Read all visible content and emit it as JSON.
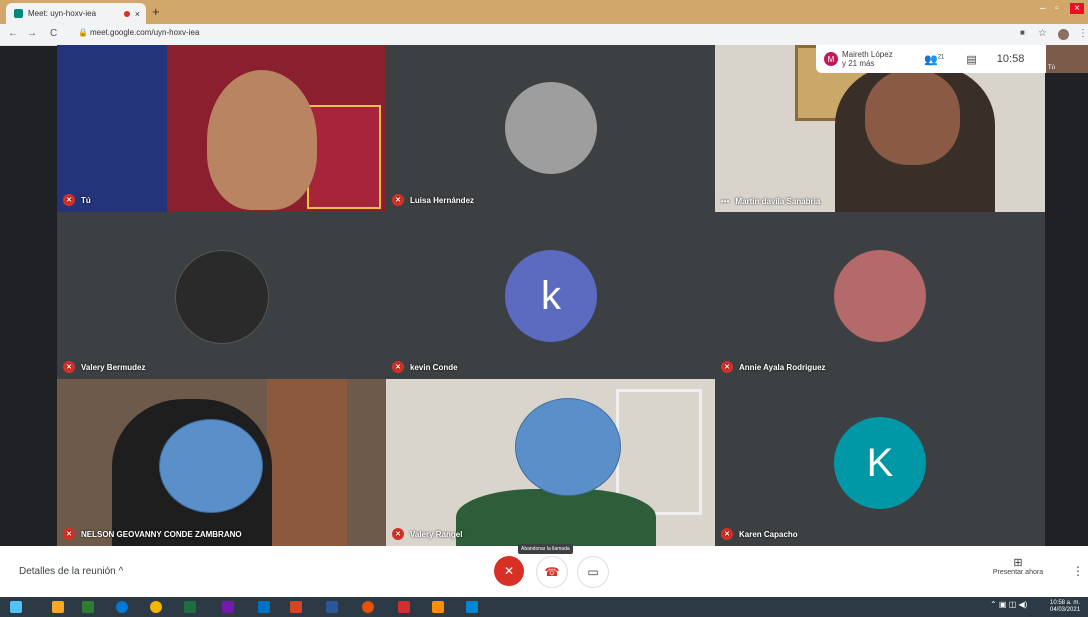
{
  "browser": {
    "tab_title": "Meet: uyn-hoxv-iea",
    "tab_close": "×",
    "new_tab": "+",
    "url": "meet.google.com/uyn-hoxv-iea",
    "back": "←",
    "forward": "→",
    "reload": "C",
    "lock": "🔒",
    "minimize": "–",
    "maximize": "▫",
    "close": "×"
  },
  "participants": [
    {
      "name": "Tú",
      "muted": true
    },
    {
      "name": "Luisa Hernández",
      "muted": true
    },
    {
      "name": "Martin davila Sanabria",
      "muted": false
    },
    {
      "name": "Valery Bermudez",
      "muted": true
    },
    {
      "name": "kevin Conde",
      "muted": true,
      "avatar_letter": "k",
      "avatar_color": "#5c6bc0"
    },
    {
      "name": "Annie Ayala Rodriguez",
      "muted": true
    },
    {
      "name": "NELSON GEOVANNY CONDE ZAMBRANO",
      "muted": true
    },
    {
      "name": "Valery Rangel",
      "muted": true
    },
    {
      "name": "Karen Capacho",
      "muted": true,
      "avatar_letter": "K",
      "avatar_color": "#0097a7"
    }
  ],
  "top_panel": {
    "presenter_initial": "M",
    "presenter_line1": "Maireth López",
    "presenter_line2": "y 21 más",
    "people_count": "21",
    "time": "10:58",
    "self_label": "Tú"
  },
  "controls": {
    "details_label": "Detalles de la reunión",
    "hangup_tooltip": "Abandonar la llamada",
    "present_label": "Presentar ahora",
    "more": "⋮"
  },
  "taskbar": {
    "time": "10:58 a. m.",
    "date": "04/03/2021"
  },
  "colors": {
    "mute_red": "#d93025",
    "tab_bar": "#d1a86a",
    "background": "#202124"
  }
}
